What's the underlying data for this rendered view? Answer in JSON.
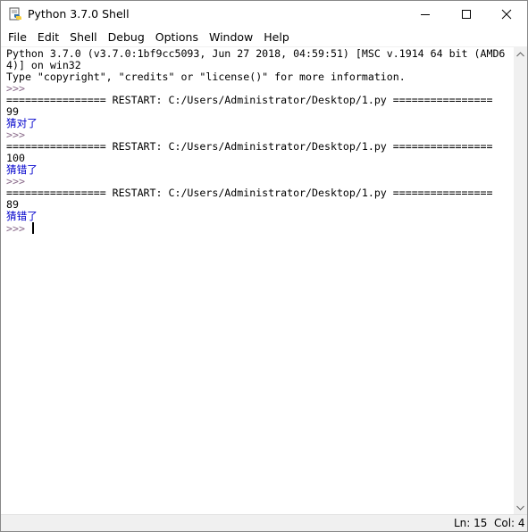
{
  "window": {
    "title": "Python 3.7.0 Shell"
  },
  "menu": [
    "File",
    "Edit",
    "Shell",
    "Debug",
    "Options",
    "Window",
    "Help"
  ],
  "shell": {
    "lines": [
      {
        "text": "Python 3.7.0 (v3.7.0:1bf9cc5093, Jun 27 2018, 04:59:51) [MSC v.1914 64 bit (AMD6",
        "kind": "plain"
      },
      {
        "text": "4)] on win32",
        "kind": "plain"
      },
      {
        "text": "Type \"copyright\", \"credits\" or \"license()\" for more information.",
        "kind": "plain"
      },
      {
        "text": ">>> ",
        "kind": "prompt"
      },
      {
        "text": "================ RESTART: C:/Users/Administrator/Desktop/1.py ================",
        "kind": "restart"
      },
      {
        "text": "99",
        "kind": "plain"
      },
      {
        "text": "猜对了",
        "kind": "stdout"
      },
      {
        "text": ">>> ",
        "kind": "prompt"
      },
      {
        "text": "================ RESTART: C:/Users/Administrator/Desktop/1.py ================",
        "kind": "restart"
      },
      {
        "text": "100",
        "kind": "plain"
      },
      {
        "text": "猜错了",
        "kind": "stdout"
      },
      {
        "text": ">>> ",
        "kind": "prompt"
      },
      {
        "text": "================ RESTART: C:/Users/Administrator/Desktop/1.py ================",
        "kind": "restart"
      },
      {
        "text": "89",
        "kind": "plain"
      },
      {
        "text": "猜错了",
        "kind": "stdout"
      },
      {
        "text": ">>> ",
        "kind": "prompt-active"
      }
    ]
  },
  "status": {
    "ln": "Ln: 15",
    "col": "Col: 4"
  },
  "colors": {
    "prompt": "#8a6b8a",
    "stdout": "#0000cc"
  }
}
